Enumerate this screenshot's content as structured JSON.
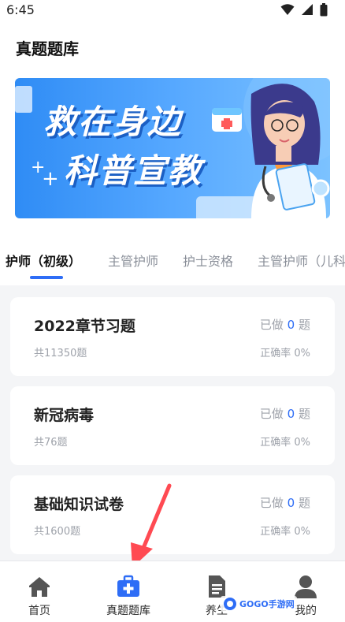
{
  "status_bar": {
    "time": "6:45"
  },
  "header": {
    "title": "真题题库"
  },
  "banner": {
    "line1": "救在身边",
    "line2": "科普宣教"
  },
  "tabs": [
    {
      "label": "护师（初级）",
      "active": true
    },
    {
      "label": "主管护师",
      "active": false
    },
    {
      "label": "护士资格",
      "active": false
    },
    {
      "label": "主管护师（儿科",
      "active": false
    }
  ],
  "cards": [
    {
      "title": "2022章节习题",
      "count": "共11350题",
      "done_prefix": "已做",
      "done_value": "0",
      "done_suffix": "题",
      "rate": "正确率 0%"
    },
    {
      "title": "新冠病毒",
      "count": "共76题",
      "done_prefix": "已做",
      "done_value": "0",
      "done_suffix": "题",
      "rate": "正确率 0%"
    },
    {
      "title": "基础知识试卷",
      "count": "共1600题",
      "done_prefix": "已做",
      "done_value": "0",
      "done_suffix": "题",
      "rate": "正确率 0%"
    }
  ],
  "bottom_nav": [
    {
      "label": "首页",
      "icon": "home-icon"
    },
    {
      "label": "真题题库",
      "icon": "medical-kit-icon",
      "active": true
    },
    {
      "label": "养生",
      "icon": "document-icon"
    },
    {
      "label": "我的",
      "icon": "user-icon"
    }
  ],
  "watermark": {
    "text": "GOGO手游网"
  },
  "colors": {
    "accent": "#2e6df6",
    "background": "#f4f5f7",
    "muted": "#9ea2aa"
  }
}
